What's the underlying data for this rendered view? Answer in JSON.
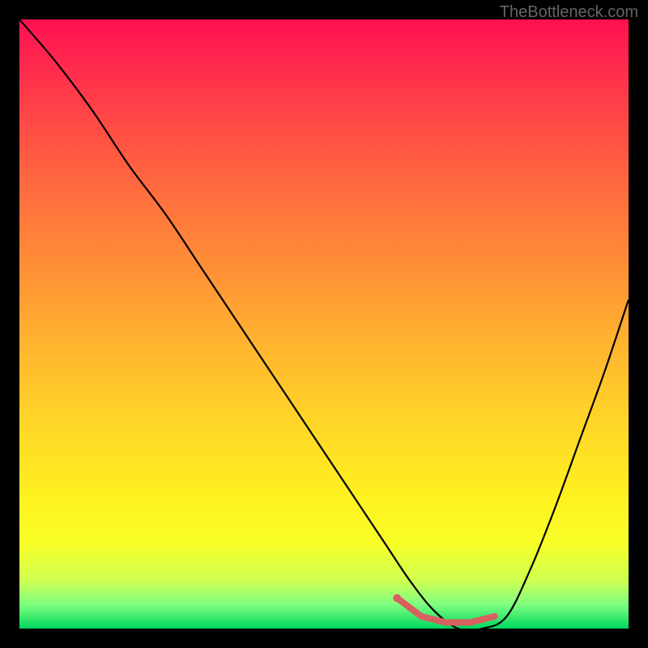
{
  "watermark": "TheBottleneck.com",
  "chart_data": {
    "type": "line",
    "title": "",
    "xlabel": "",
    "ylabel": "",
    "xlim": [
      0,
      100
    ],
    "ylim": [
      0,
      100
    ],
    "curve_main": {
      "x": [
        0,
        6,
        12,
        18,
        24,
        30,
        36,
        42,
        48,
        54,
        60,
        64,
        68,
        72,
        76,
        80,
        84,
        88,
        92,
        96,
        100
      ],
      "y": [
        100,
        93,
        85,
        76,
        68,
        59,
        50,
        41,
        32,
        23,
        14,
        8,
        3,
        0,
        0,
        2,
        10,
        20,
        31,
        42,
        54
      ]
    },
    "highlight_segment": {
      "x": [
        62,
        66,
        70,
        74,
        78
      ],
      "y": [
        5,
        2,
        1,
        1,
        2
      ]
    },
    "colors": {
      "gradient_top": "#ff1050",
      "gradient_mid": "#ffd528",
      "gradient_bottom": "#00d860",
      "curve": "#000000",
      "highlight": "#e06060"
    }
  }
}
